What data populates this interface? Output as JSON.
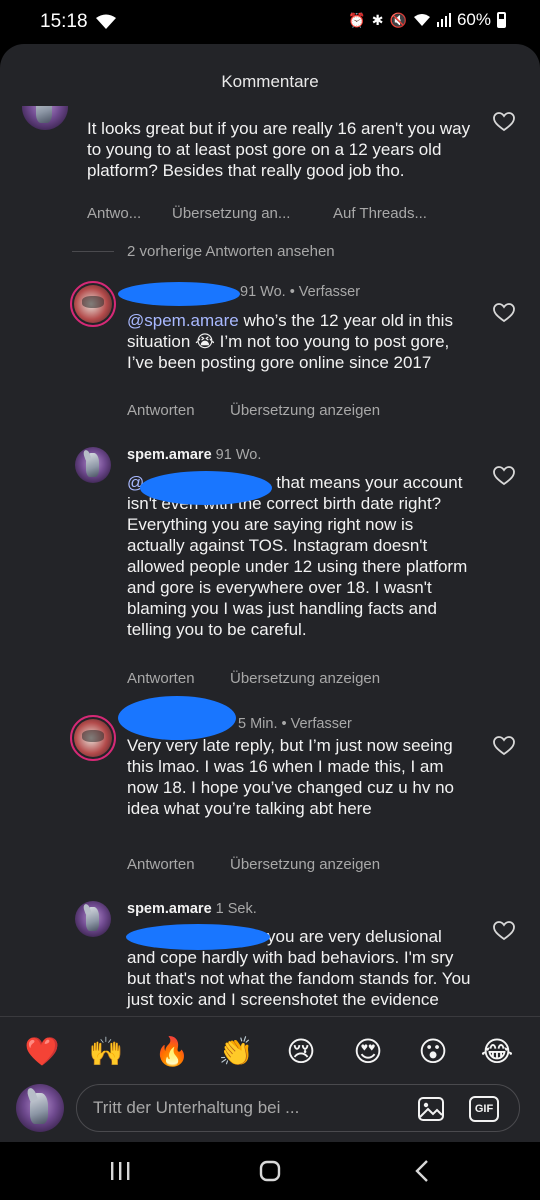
{
  "status": {
    "time": "15:18",
    "battery": "60%"
  },
  "sheet": {
    "title": "Kommentare"
  },
  "comments": [
    {
      "text": "It looks great but if you are really 16 aren't you way to young to at least post gore on a 12 years old platform? Besides that really good job tho.",
      "actions": [
        "Antwo...",
        "Übersetzung an...",
        "Auf Threads..."
      ]
    }
  ],
  "view_replies": "2 vorherige Antworten ansehen",
  "replies": [
    {
      "meta": "91 Wo. • Verfasser",
      "mention": "@spem.amare",
      "text": " who’s the 12 year old in this situation 😭 I’m not too young to post gore, I’ve been posting gore online since 2017",
      "reply": "Antworten",
      "translate": "Übersetzung anzeigen"
    },
    {
      "user": "spem.amare",
      "meta": "91 Wo.",
      "mention": "@",
      "text": "that means your account isn't even with the correct birth date right? Everything you are saying right now is actually against TOS. Instagram doesn't allowed people under 12 using there platform and gore is everywhere over 18. I wasn't blaming you I was just handling facts and telling you to be careful.",
      "reply": "Antworten",
      "translate": "Übersetzung anzeigen"
    },
    {
      "meta": "5 Min. • Verfasser",
      "text": "Very very late reply, but I’m just now seeing this lmao. I was 16 when I made this, I am now 18. I hope you’ve changed cuz u hv no idea what you’re talking abt here",
      "reply": "Antworten",
      "translate": "Übersetzung anzeigen"
    },
    {
      "user": "spem.amare",
      "meta": "1 Sek.",
      "text": "you are very delusional and cope hardly with bad behaviors. I'm sry but that's not what the fandom stands for. You just toxic and I screenshotet the evidence"
    }
  ],
  "emoji_bar": [
    "❤️",
    "🙌",
    "🔥",
    "👏",
    "😢",
    "😍",
    "😮",
    "😂"
  ],
  "input": {
    "placeholder": "Tritt der Unterhaltung bei ...",
    "gif_label": "GIF"
  },
  "colors": {
    "sheet_bg": "#232428",
    "mention": "#a9b9ff",
    "redaction": "#1976ff",
    "muted": "#a8a8a8"
  },
  "icons": [
    "heart-outline-icon",
    "image-icon",
    "gif-icon",
    "recents-icon",
    "home-icon",
    "back-icon",
    "wifi-icon",
    "bluetooth-icon",
    "battery-icon"
  ]
}
